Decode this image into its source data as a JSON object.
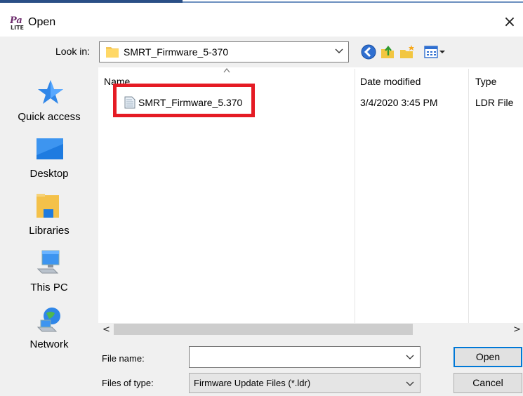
{
  "window": {
    "title": "Open",
    "app_icon": "padlite-app-icon",
    "close_glyph": "×"
  },
  "toolbar": {
    "look_in_label": "Look in:",
    "look_in_value": "SMRT_Firmware_5-370",
    "icons": [
      "back-icon",
      "up-folder-icon",
      "new-folder-icon",
      "views-menu-icon"
    ]
  },
  "places": [
    {
      "label": "Quick access",
      "icon": "star-icon"
    },
    {
      "label": "Desktop",
      "icon": "desktop-icon"
    },
    {
      "label": "Libraries",
      "icon": "libraries-icon"
    },
    {
      "label": "This PC",
      "icon": "computer-icon"
    },
    {
      "label": "Network",
      "icon": "network-icon"
    }
  ],
  "filelist": {
    "columns": [
      "Name",
      "Date modified",
      "Type"
    ],
    "rows": [
      {
        "name": "SMRT_Firmware_5.370",
        "date": "3/4/2020 3:45 PM",
        "type": "LDR File",
        "icon": "file-icon"
      }
    ]
  },
  "scroll": {
    "left": "<",
    "right": ">"
  },
  "form": {
    "file_name_label": "File name:",
    "file_name_value": "",
    "files_of_type_label": "Files of type:",
    "files_of_type_value": "Firmware Update Files (*.ldr)"
  },
  "buttons": {
    "open": "Open",
    "cancel": "Cancel"
  },
  "colors": {
    "highlight": "#e51b24",
    "accent": "#0078d7"
  }
}
